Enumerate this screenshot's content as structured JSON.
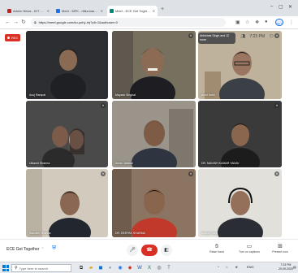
{
  "browser": {
    "tabs": [
      {
        "title": "Admin News - IDT Alumni Pal",
        "color": "#c5221f",
        "active": false
      },
      {
        "title": "Meet - MFK - ritika.kashimanim",
        "color": "#1a73e8",
        "active": false
      },
      {
        "title": "Meet - ECE Get Together",
        "color": "#00897b",
        "active": true
      }
    ],
    "new_tab": "+",
    "url": "https://meet.google.com/ku-yuhy-hrj?pli=1&authuser=0",
    "profile_label": "Sign in"
  },
  "meet": {
    "recording_label": "REC",
    "presenting_text": "Abhishek Singh and 12 more",
    "clock": "7:23 PM",
    "participants": [
      {
        "name": "Anuj Rampal",
        "muted": false
      },
      {
        "name": "Mayank Singhal",
        "muted": true
      },
      {
        "name": "Ankit Sethi",
        "muted": true
      },
      {
        "name": "Utkarsh Sharma",
        "muted": true
      },
      {
        "name": "Aman Jaiswal",
        "muted": false
      },
      {
        "name": "DR. MANISH KUMAR YADAV",
        "muted": true
      },
      {
        "name": "Saurabh Sharma",
        "muted": true
      },
      {
        "name": "DR. DEEPAK SHARMA",
        "muted": true
      },
      {
        "name": "Anurag Garg",
        "muted": true
      }
    ],
    "meeting_title": "ECE Get Together",
    "bottom_controls": [
      {
        "label": "Raise hand",
        "icon": "hand-icon"
      },
      {
        "label": "Turn on captions",
        "icon": "captions-icon"
      },
      {
        "label": "Present now",
        "icon": "present-icon"
      }
    ]
  },
  "taskbar": {
    "search_placeholder": "Type here to search",
    "tray_text": "ENG",
    "time": "7:23 PM",
    "date": "20-09-2020"
  },
  "colors": {
    "accent": "#1a73e8",
    "end_call": "#d93025",
    "recording": "#d93025"
  }
}
